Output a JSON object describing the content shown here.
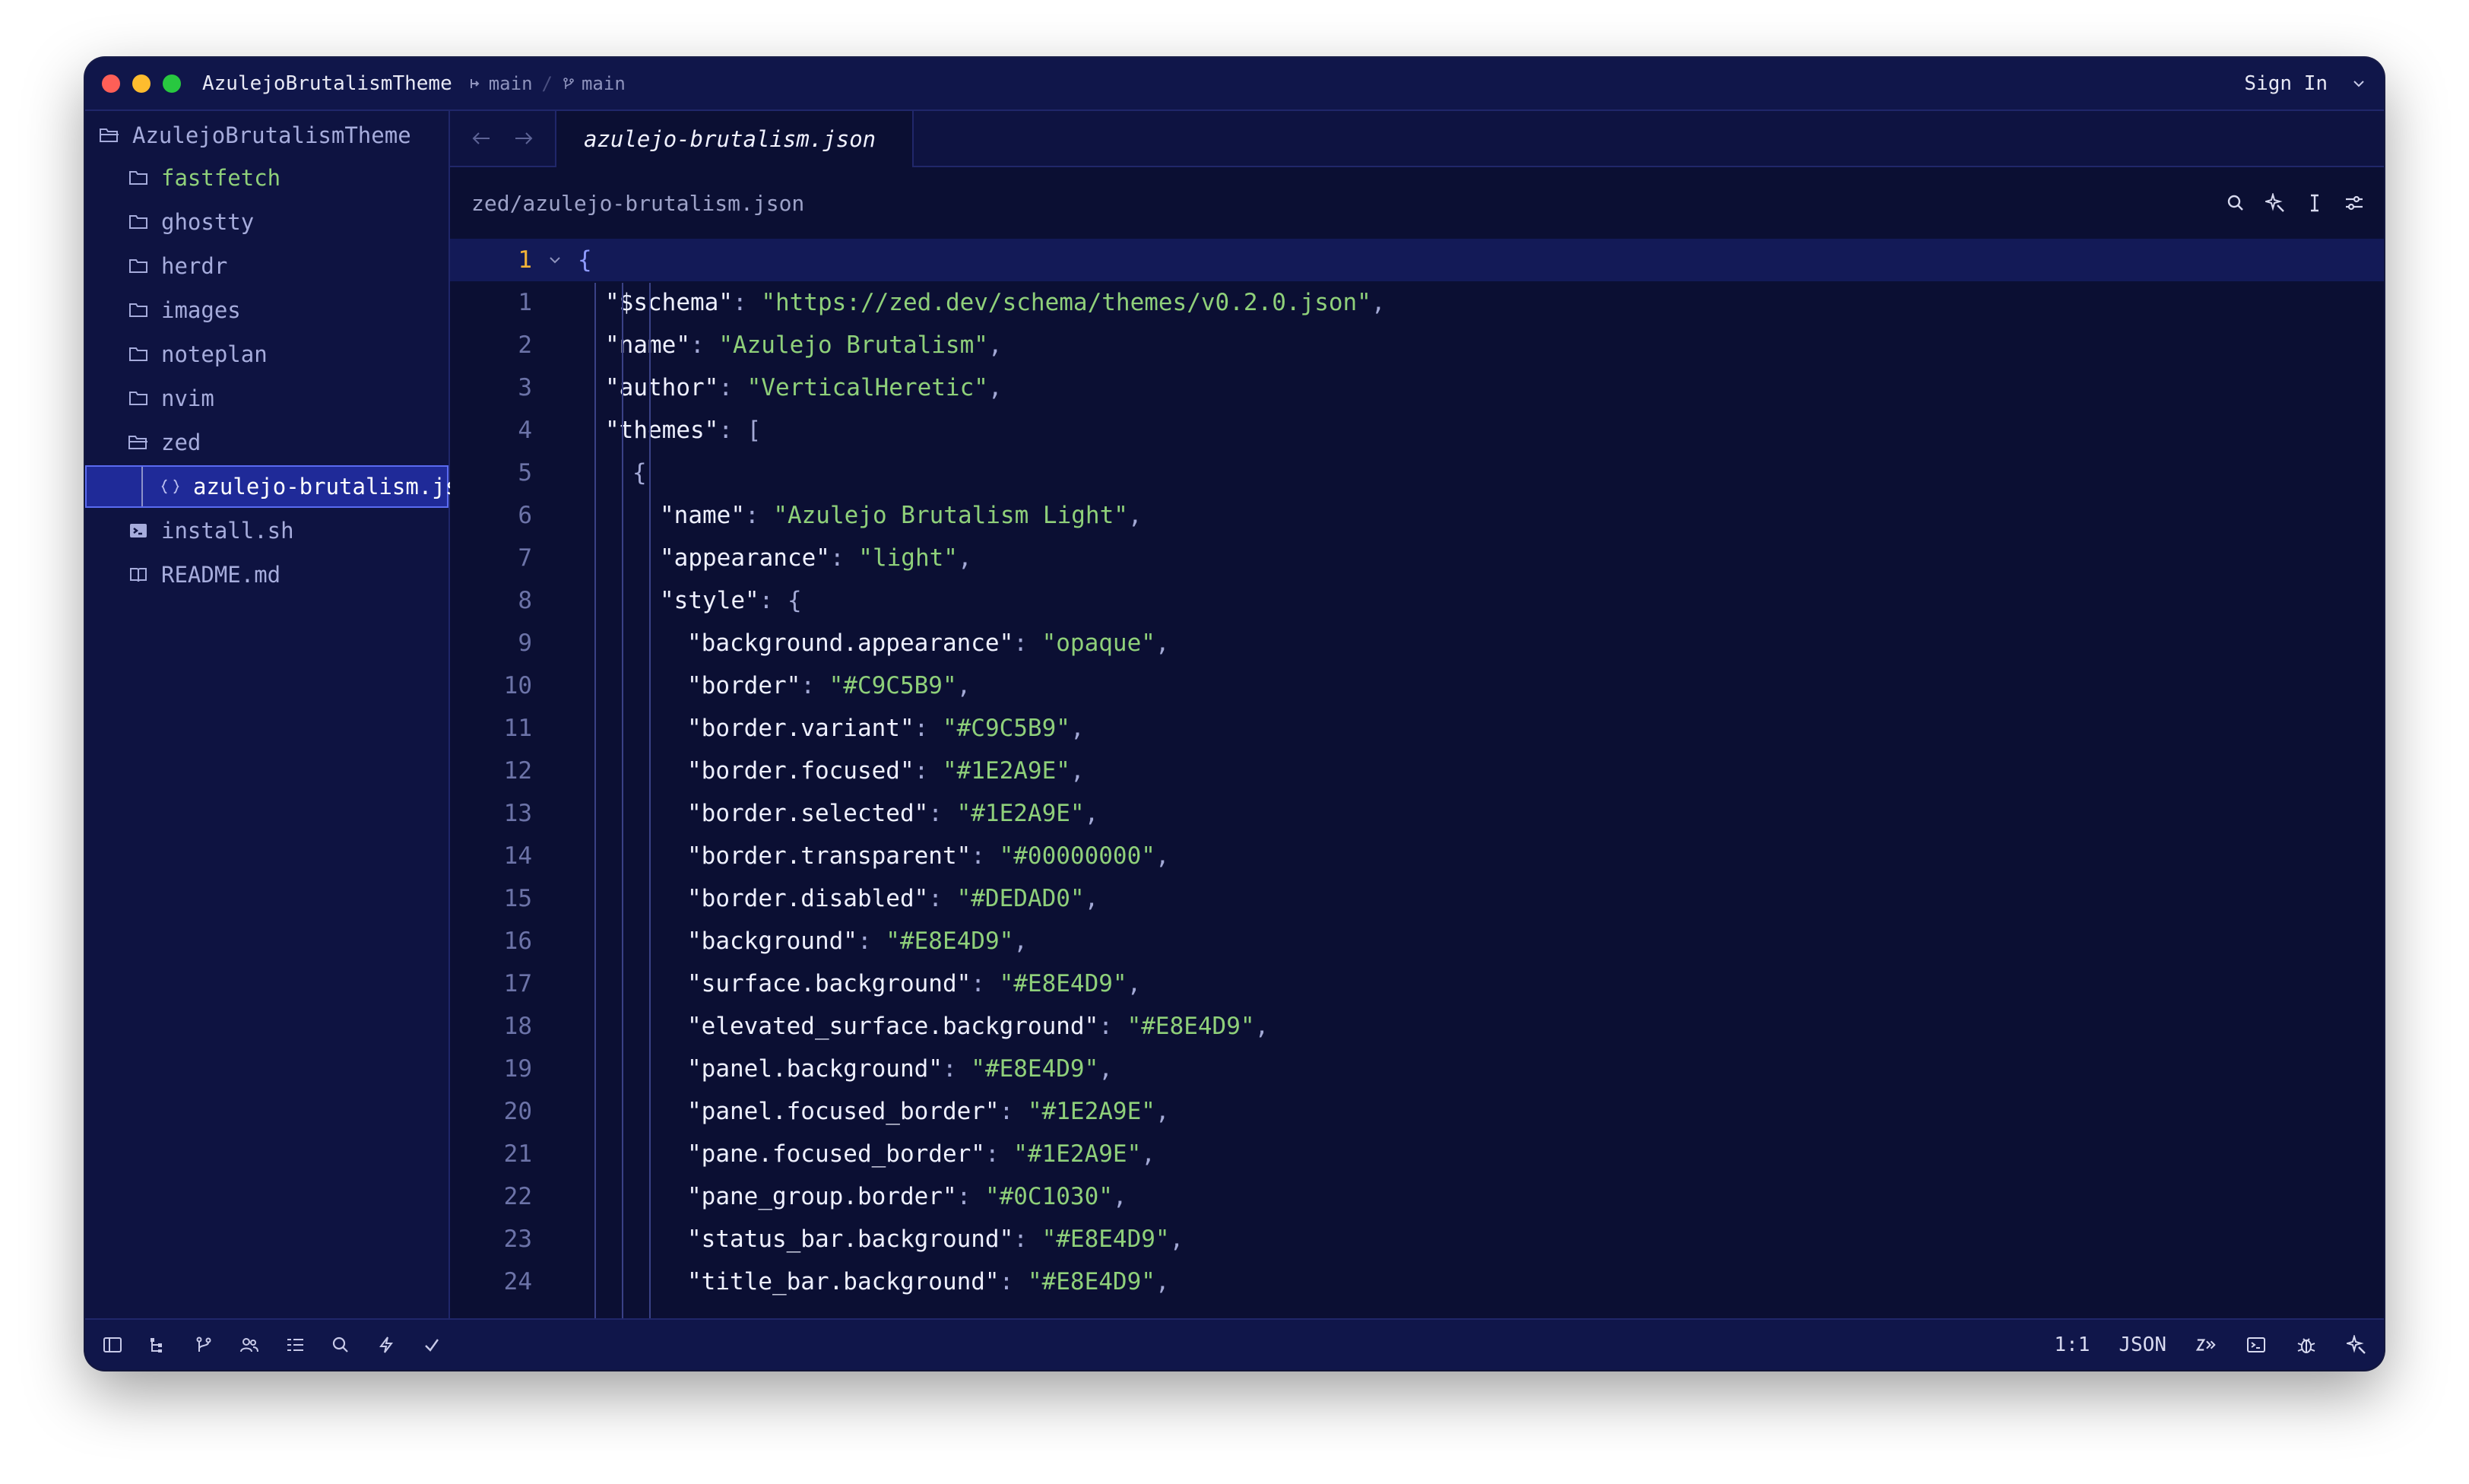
{
  "window": {
    "project_name": "AzulejoBrutalismTheme",
    "branch_1": "main",
    "branch_2": "main",
    "sign_in": "Sign In"
  },
  "sidebar": {
    "root": "AzulejoBrutalismTheme",
    "items": [
      {
        "label": "fastfetch",
        "kind": "folder-icon",
        "git_modified": true
      },
      {
        "label": "ghostty",
        "kind": "folder-icon"
      },
      {
        "label": "herdr",
        "kind": "folder-icon"
      },
      {
        "label": "images",
        "kind": "folder-icon"
      },
      {
        "label": "noteplan",
        "kind": "folder-icon"
      },
      {
        "label": "nvim",
        "kind": "folder-icon"
      },
      {
        "label": "zed",
        "kind": "folder-open-icon"
      },
      {
        "label": "azulejo-brutalism.json",
        "kind": "json-icon",
        "selected": true
      },
      {
        "label": "install.sh",
        "kind": "terminal-icon"
      },
      {
        "label": "README.md",
        "kind": "book-icon"
      }
    ]
  },
  "editor": {
    "tab_label": "azulejo-brutalism.json",
    "breadcrumb": "zed/azulejo-brutalism.json",
    "lines": [
      {
        "num": "1",
        "text": "{"
      },
      {
        "num": "1",
        "key": "\"$schema\"",
        "val": "\"https://zed.dev/schema/themes/v0.2.0.json\"",
        "tail": ","
      },
      {
        "num": "2",
        "key": "\"name\"",
        "val": "\"Azulejo Brutalism\"",
        "tail": ","
      },
      {
        "num": "3",
        "key": "\"author\"",
        "val": "\"VerticalHeretic\"",
        "tail": ","
      },
      {
        "num": "4",
        "key": "\"themes\"",
        "val": "",
        "tail": "["
      },
      {
        "num": "5",
        "text": "{"
      },
      {
        "num": "6",
        "key": "\"name\"",
        "val": "\"Azulejo Brutalism Light\"",
        "tail": ","
      },
      {
        "num": "7",
        "key": "\"appearance\"",
        "val": "\"light\"",
        "tail": ","
      },
      {
        "num": "8",
        "key": "\"style\"",
        "val": "",
        "tail": "{"
      },
      {
        "num": "9",
        "key": "\"background.appearance\"",
        "val": "\"opaque\"",
        "tail": ","
      },
      {
        "num": "10",
        "key": "\"border\"",
        "val": "\"#C9C5B9\"",
        "tail": ","
      },
      {
        "num": "11",
        "key": "\"border.variant\"",
        "val": "\"#C9C5B9\"",
        "tail": ","
      },
      {
        "num": "12",
        "key": "\"border.focused\"",
        "val": "\"#1E2A9E\"",
        "tail": ","
      },
      {
        "num": "13",
        "key": "\"border.selected\"",
        "val": "\"#1E2A9E\"",
        "tail": ","
      },
      {
        "num": "14",
        "key": "\"border.transparent\"",
        "val": "\"#00000000\"",
        "tail": ","
      },
      {
        "num": "15",
        "key": "\"border.disabled\"",
        "val": "\"#DEDAD0\"",
        "tail": ","
      },
      {
        "num": "16",
        "key": "\"background\"",
        "val": "\"#E8E4D9\"",
        "tail": ","
      },
      {
        "num": "17",
        "key": "\"surface.background\"",
        "val": "\"#E8E4D9\"",
        "tail": ","
      },
      {
        "num": "18",
        "key": "\"elevated_surface.background\"",
        "val": "\"#E8E4D9\"",
        "tail": ","
      },
      {
        "num": "19",
        "key": "\"panel.background\"",
        "val": "\"#E8E4D9\"",
        "tail": ","
      },
      {
        "num": "20",
        "key": "\"panel.focused_border\"",
        "val": "\"#1E2A9E\"",
        "tail": ","
      },
      {
        "num": "21",
        "key": "\"pane.focused_border\"",
        "val": "\"#1E2A9E\"",
        "tail": ","
      },
      {
        "num": "22",
        "key": "\"pane_group.border\"",
        "val": "\"#0C1030\"",
        "tail": ","
      },
      {
        "num": "23",
        "key": "\"status_bar.background\"",
        "val": "\"#E8E4D9\"",
        "tail": ","
      },
      {
        "num": "24",
        "key": "\"title_bar.background\"",
        "val": "\"#E8E4D9\"",
        "tail": ","
      }
    ]
  },
  "statusbar": {
    "cursor_position": "1:1",
    "language": "JSON"
  },
  "colors": {
    "background": "#0b0f33",
    "panel": "#0e1341",
    "selection": "#1f2a98",
    "string": "#8fd07a",
    "active_line_number": "#f2b338"
  }
}
